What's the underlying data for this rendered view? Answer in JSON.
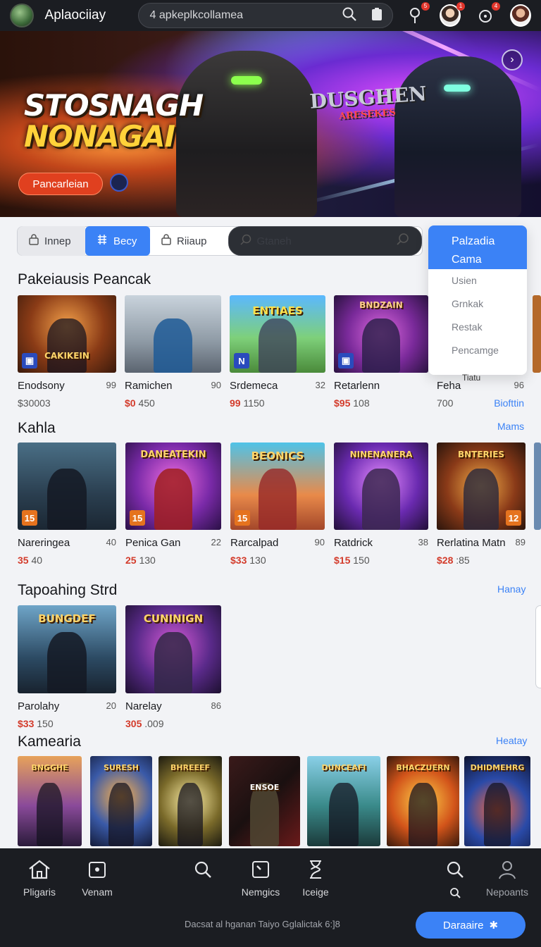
{
  "header": {
    "app_title": "Aplaociiay",
    "search_text": "4 apkeplkcollamea",
    "icons": [
      "search-icon",
      "notification-icon",
      "controller-icon",
      "profile-avatar",
      "settings-icon",
      "user-avatar"
    ],
    "badge_values": [
      "5",
      "1",
      "4"
    ]
  },
  "hero": {
    "title_line1": "STOSNAGH",
    "title_line2": "NONAGAI",
    "logo_text": "DUSGHEN",
    "logo_sub": "ARESEKES",
    "button_label": "Pancarleian"
  },
  "filters": {
    "items": [
      {
        "label": "Innep"
      },
      {
        "label": "Becy"
      },
      {
        "label": "Riiaup"
      },
      {
        "label": "Gtaneh"
      }
    ]
  },
  "dropdown": {
    "header_line1": "Palzadia",
    "header_line2": "Cama",
    "items": [
      "Usien",
      "Grnkak",
      "Restak",
      "Pencamge"
    ]
  },
  "sections": [
    {
      "title": "Pakeiausis Peancak",
      "link": "",
      "cards": [
        {
          "title": "Enodsony",
          "rating": "99",
          "price_red": "",
          "price": "$30003",
          "thumb_text": "CAKIKEIN"
        },
        {
          "title": "Ramichen",
          "rating": "90",
          "price_red": "$0",
          "price": "450",
          "thumb_text": ""
        },
        {
          "title": "Srdemeca",
          "rating": "32",
          "price_red": "99",
          "price": "1150",
          "thumb_text": "ENTIAES"
        },
        {
          "title": "Retarlenn",
          "rating": "",
          "price_red": "$95",
          "price": "108",
          "thumb_text": "BNDZAIN"
        },
        {
          "title": "Feha",
          "rating": "96",
          "price_red": "",
          "price": "700",
          "thumb_text": "",
          "extra": "Tiatu",
          "link": "Biofttin"
        }
      ]
    },
    {
      "title": "Kahla",
      "link": "Mams",
      "cards": [
        {
          "title": "Nareringea",
          "rating": "40",
          "price_red": "35",
          "price": "40",
          "thumb_text": "",
          "badge": "15"
        },
        {
          "title": "Penica Gan",
          "rating": "22",
          "price_red": "25",
          "price": "130",
          "thumb_text": "DANEATEKIN",
          "badge": "15"
        },
        {
          "title": "Rarcalpad",
          "rating": "90",
          "price_red": "$33",
          "price": "130",
          "thumb_text": "BEONICS",
          "badge": "15"
        },
        {
          "title": "Ratdrick",
          "rating": "38",
          "price_red": "$15",
          "price": "150",
          "thumb_text": "NINENANERA",
          "badge": ""
        },
        {
          "title": "Rerlatina Matn",
          "rating": "89",
          "price_red": "$28",
          "price": ":85",
          "thumb_text": "BNTERIES",
          "badge": "12"
        }
      ]
    },
    {
      "title": "Tapoahing Strd",
      "link": "Hanay",
      "cards": [
        {
          "title": "Parolahy",
          "rating": "20",
          "price_red": "$33",
          "price": "150",
          "thumb_text": "BUNGDEF"
        },
        {
          "title": "Narelay",
          "rating": "86",
          "price_red": "305",
          "price": ".009",
          "thumb_text": "CUNINIGN"
        }
      ]
    },
    {
      "title": "Kamearia",
      "link": "Heatay",
      "cards": [
        {
          "thumb_text": "BNGGHE"
        },
        {
          "thumb_text": "SURESH"
        },
        {
          "thumb_text": "BHREEEF"
        },
        {
          "thumb_text": "ENSOE"
        },
        {
          "thumb_text": "DUNCEAFI"
        },
        {
          "thumb_text": "BHACZUERN"
        },
        {
          "thumb_text": "DHIDMEHRG"
        }
      ]
    }
  ],
  "bottom_nav": {
    "items": [
      "Pligaris",
      "Venam",
      "",
      "Nemgics",
      "Iceige",
      "",
      "Nepoants"
    ],
    "footnote": "Dacsat al hganan Taiyo Gglalictak 6:]8",
    "cta_label": "Daraaire"
  },
  "colors": {
    "accent": "#3b82f6",
    "price_red": "#d33b2b",
    "hero_button": "#e0401f",
    "topbar": "#1b1d22"
  }
}
